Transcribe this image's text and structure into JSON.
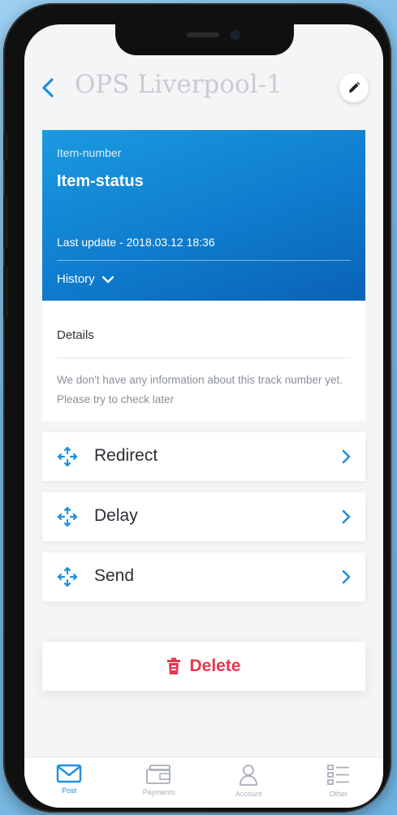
{
  "header": {
    "title": "OPS Liverpool-1",
    "back_icon": "chevron-left-icon",
    "edit_icon": "pencil-icon"
  },
  "status": {
    "item_number": "Item-number",
    "item_status": "Item-status",
    "last_update": "Last update - 2018.03.12 18:36",
    "history_label": "History"
  },
  "details": {
    "heading": "Details",
    "text": "We don't have any information about this track number yet. Please try to check later"
  },
  "actions": [
    {
      "label": "Redirect",
      "icon": "move-arrows-icon"
    },
    {
      "label": "Delay",
      "icon": "move-arrows-icon"
    },
    {
      "label": "Send",
      "icon": "move-arrows-icon"
    }
  ],
  "delete": {
    "label": "Delete",
    "icon": "trash-icon"
  },
  "tabs": [
    {
      "label": "Post",
      "icon": "envelope-icon",
      "active": true
    },
    {
      "label": "Payments",
      "icon": "wallet-icon",
      "active": false
    },
    {
      "label": "Account",
      "icon": "user-icon",
      "active": false
    },
    {
      "label": "Other",
      "icon": "list-icon",
      "active": false
    }
  ],
  "colors": {
    "accent": "#1e8fe0",
    "card_blue": "#0f7ccd",
    "danger": "#e8354d"
  }
}
